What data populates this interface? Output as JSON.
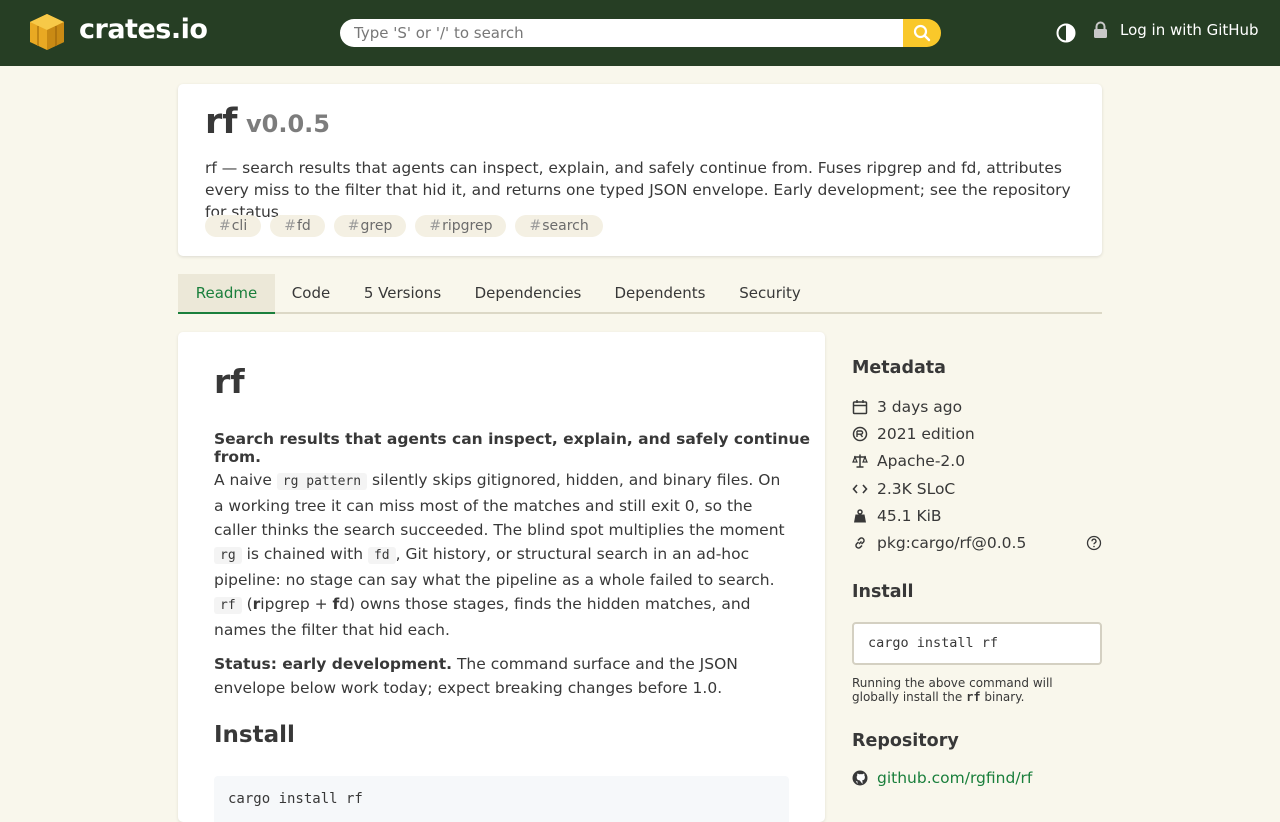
{
  "header": {
    "brand": "crates.io",
    "search_placeholder": "Type 'S' or '/' to search",
    "login_label": "Log in with GitHub"
  },
  "crate": {
    "name": "rf",
    "version": "v0.0.5",
    "description": "rf — search results that agents can inspect, explain, and safely continue from. Fuses ripgrep and fd, attributes every miss to the filter that hid it, and returns one typed JSON envelope. Early development; see the repository for status.",
    "keywords": [
      "cli",
      "fd",
      "grep",
      "ripgrep",
      "search"
    ]
  },
  "tabs": [
    "Readme",
    "Code",
    "5 Versions",
    "Dependencies",
    "Dependents",
    "Security"
  ],
  "readme": {
    "title": "rf",
    "tagline": "Search results that agents can inspect, explain, and safely continue from.",
    "p1": {
      "t1": "A naive ",
      "c1": "rg pattern",
      "t2": " silently skips gitignored, hidden, and binary files. On a working tree it can miss most of the matches and still exit 0, so the caller thinks the search succeeded. The blind spot multiplies the moment ",
      "c2": "rg",
      "t3": " is chained with ",
      "c3": "fd",
      "t4": ", Git history, or structural search in an ad-hoc pipeline: no stage can say what the pipeline as a whole failed to search. ",
      "c4": "rf",
      "t5": " (",
      "b1": "r",
      "t6": "ipgrep + ",
      "b2": "f",
      "t7": "d) owns those stages, finds the hidden matches, and names the filter that hid each."
    },
    "p2": {
      "bold": "Status: early development.",
      "rest": " The command surface and the JSON envelope below work today; expect breaking changes before 1.0."
    },
    "install_heading": "Install",
    "install_code": "cargo install rf"
  },
  "sidebar": {
    "metadata_heading": "Metadata",
    "published": "3 days ago",
    "edition": "2021 edition",
    "license": "Apache-2.0",
    "sloc": "2.3K SLoC",
    "size": "45.1 KiB",
    "purl": "pkg:cargo/rf@0.0.5",
    "install_heading": "Install",
    "install_command": "cargo install rf",
    "install_note_pre": "Running the above command will globally install the ",
    "install_note_bin": "rf",
    "install_note_post": " binary.",
    "repository_heading": "Repository",
    "repository_link": "github.com/rgfind/rf"
  },
  "colors": {
    "header_bg": "#263e24",
    "page_bg": "#f9f7ec",
    "search_button": "#f9c82a",
    "accent_green": "#1a7f3c"
  }
}
